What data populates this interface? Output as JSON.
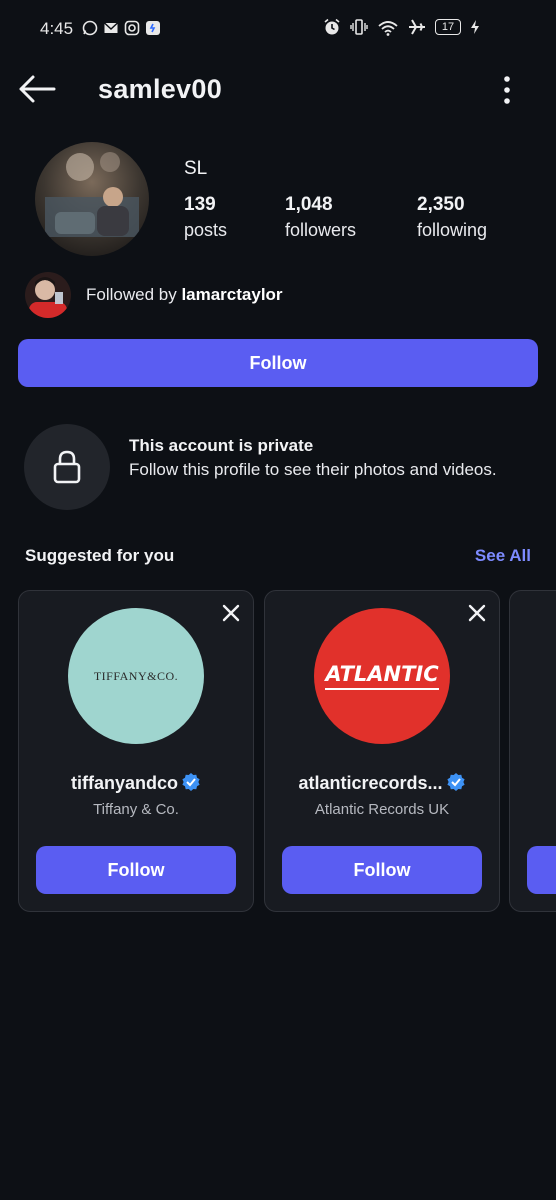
{
  "status": {
    "time": "4:45",
    "battery": "17"
  },
  "header": {
    "username": "samlev00"
  },
  "profile": {
    "fullname": "SL",
    "stats": [
      {
        "num": "139",
        "label": "posts"
      },
      {
        "num": "1,048",
        "label": "followers"
      },
      {
        "num": "2,350",
        "label": "following"
      }
    ],
    "followed_prefix": "Followed by ",
    "followed_user": "lamarctaylor",
    "follow_label": "Follow"
  },
  "private": {
    "title": "This account is private",
    "text": "Follow this profile to see their photos and videos."
  },
  "suggested": {
    "title": "Suggested for you",
    "see_all": "See All",
    "cards": [
      {
        "handle": "tiffanyandco",
        "name": "Tiffany & Co.",
        "logo_text": "TIFFANY&CO.",
        "button": "Follow",
        "logo_color": "#9fd5cf"
      },
      {
        "handle": "atlanticrecords...",
        "name": "Atlantic Records UK",
        "logo_text": "ATLANTIC",
        "button": "Follow",
        "logo_color": "#e1312b"
      }
    ]
  },
  "colors": {
    "accent": "#5a5df2",
    "link": "#7d8bff",
    "verified": "#3d92f5"
  }
}
